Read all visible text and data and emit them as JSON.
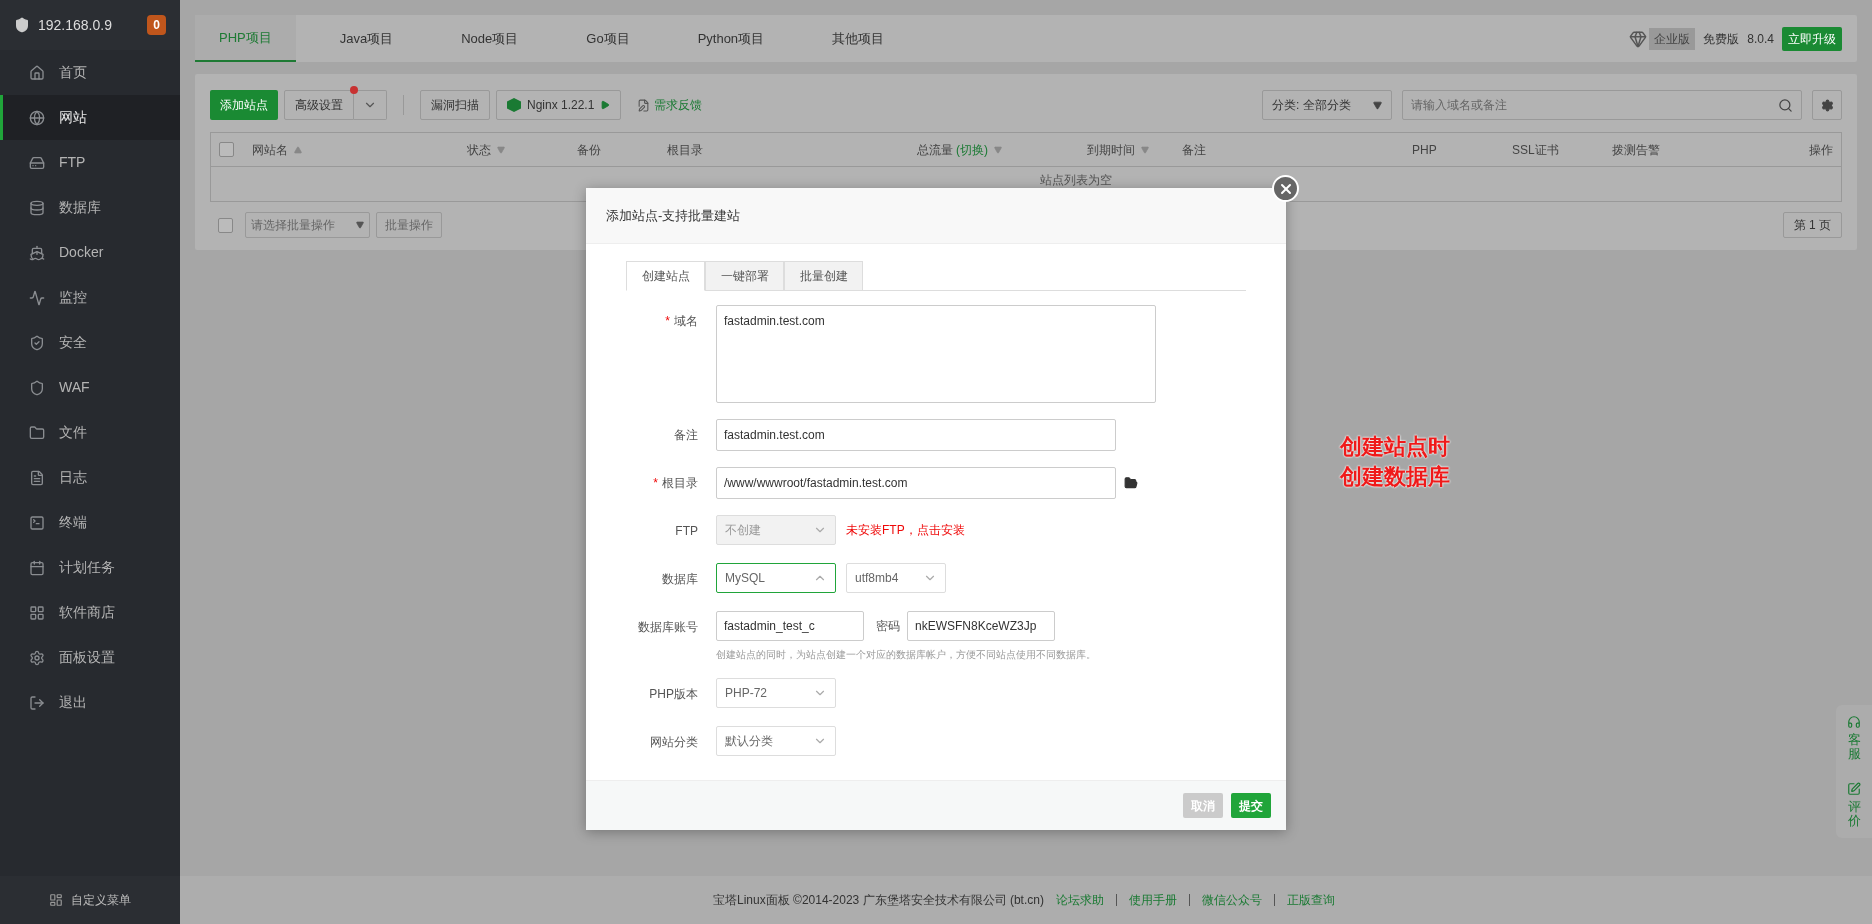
{
  "server": {
    "ip": "192.168.0.9",
    "badge": "0"
  },
  "sidebar": {
    "items": [
      {
        "label": "首页",
        "selected": false
      },
      {
        "label": "网站",
        "selected": true
      },
      {
        "label": "FTP",
        "selected": false
      },
      {
        "label": "数据库",
        "selected": false
      },
      {
        "label": "Docker",
        "selected": false
      },
      {
        "label": "监控",
        "selected": false
      },
      {
        "label": "安全",
        "selected": false
      },
      {
        "label": "WAF",
        "selected": false
      },
      {
        "label": "文件",
        "selected": false
      },
      {
        "label": "日志",
        "selected": false
      },
      {
        "label": "终端",
        "selected": false
      },
      {
        "label": "计划任务",
        "selected": false
      },
      {
        "label": "软件商店",
        "selected": false
      },
      {
        "label": "面板设置",
        "selected": false
      },
      {
        "label": "退出",
        "selected": false
      }
    ],
    "footer": "自定义菜单"
  },
  "project_tabs": [
    {
      "label": "PHP项目",
      "selected": true
    },
    {
      "label": "Java项目",
      "selected": false
    },
    {
      "label": "Node项目",
      "selected": false
    },
    {
      "label": "Go项目",
      "selected": false
    },
    {
      "label": "Python项目",
      "selected": false
    },
    {
      "label": "其他项目",
      "selected": false
    }
  ],
  "edition": {
    "enterprise": "企业版",
    "free": "免费版",
    "version": "8.0.4",
    "upgrade": "立即升级"
  },
  "toolbar": {
    "add_site": "添加站点",
    "advanced": "高级设置",
    "advanced_notice": true,
    "vuln_scan": "漏洞扫描",
    "nginx": "Nginx 1.22.1",
    "feedback": "需求反馈",
    "category": "分类: 全部分类",
    "search_placeholder": "请输入域名或备注"
  },
  "table": {
    "columns": [
      {
        "label": "网站名",
        "sortable": true
      },
      {
        "label": "状态",
        "sortable": true
      },
      {
        "label": "备份",
        "sortable": false
      },
      {
        "label": "根目录",
        "sortable": false
      },
      {
        "label": "总流量",
        "link": "(切换)",
        "sortable": true
      },
      {
        "label": "到期时间",
        "sortable": true
      },
      {
        "label": "备注",
        "sortable": false
      },
      {
        "label": "PHP",
        "sortable": false
      },
      {
        "label": "SSL证书",
        "sortable": false
      },
      {
        "label": "拨测告警",
        "sortable": false
      },
      {
        "label": "操作",
        "sortable": false
      }
    ],
    "select_all_checked": false,
    "empty": "站点列表为空"
  },
  "batch": {
    "checked": false,
    "placeholder": "请选择批量操作",
    "button": "批量操作",
    "page": "第 1 页"
  },
  "dialog": {
    "title": "添加站点-支持批量建站",
    "tabs": [
      {
        "label": "创建站点",
        "selected": true
      },
      {
        "label": "一键部署",
        "selected": false
      },
      {
        "label": "批量创建",
        "selected": false
      }
    ],
    "fields": [
      {
        "kind": "textarea",
        "label": "域名",
        "mark": "*",
        "value": "fastadmin.test.com"
      },
      {
        "kind": "text",
        "label": "备注",
        "value": "fastadmin.test.com"
      },
      {
        "kind": "path",
        "label": "根目录",
        "mark": "*",
        "value": "/www/wwwroot/fastadmin.test.com"
      },
      {
        "kind": "select",
        "label": "FTP",
        "value": "不创建",
        "disabled": true,
        "open": false,
        "note": "未安装FTP，点击安装"
      },
      {
        "kind": "select",
        "label": "数据库",
        "value": "MySQL",
        "disabled": false,
        "open": true,
        "extra": "utf8mb4"
      },
      {
        "kind": "account",
        "label": "数据库账号",
        "value": "fastadmin_test_c",
        "password_label": "密码",
        "password": "nkEWSFN8KceWZ3Jp",
        "hint": "创建站点的同时，为站点创建一个对应的数据库帐户，方便不同站点使用不同数据库。"
      },
      {
        "kind": "select",
        "label": "PHP版本",
        "value": "PHP-72",
        "disabled": false,
        "open": false
      },
      {
        "kind": "select",
        "label": "网站分类",
        "value": "默认分类",
        "disabled": false,
        "open": false
      }
    ],
    "cancel": "取消",
    "submit": "提交"
  },
  "annotation": [
    "创建站点时",
    "创建数据库"
  ],
  "side_widget": [
    {
      "label": "客服"
    },
    {
      "label": "评价"
    }
  ],
  "footer": {
    "copyright": "宝塔Linux面板 ©2014-2023 广东堡塔安全技术有限公司 (bt.cn)",
    "links": [
      "论坛求助",
      "使用手册",
      "微信公众号",
      "正版查询"
    ]
  }
}
